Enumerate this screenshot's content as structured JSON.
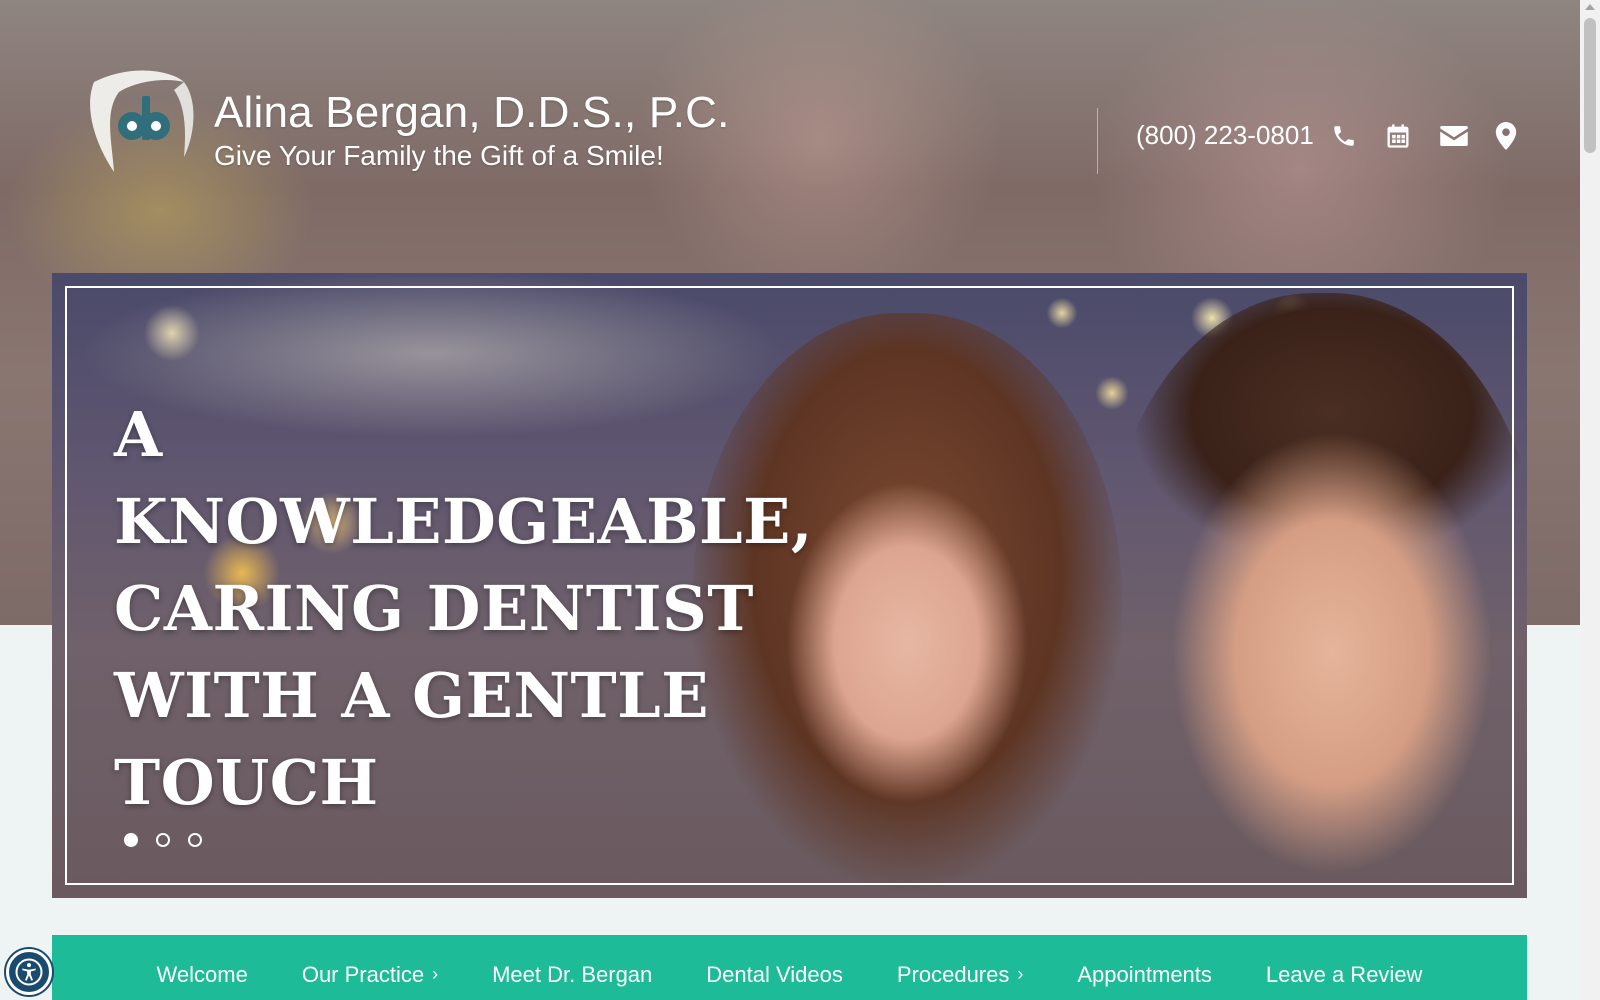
{
  "header": {
    "brand_name": "Alina Bergan, D.D.S., P.C.",
    "tagline": "Give Your Family the Gift of a Smile!",
    "phone": "(800) 223-0801",
    "logo_letters": "ab"
  },
  "contact_icons": [
    "phone-icon",
    "calendar-icon",
    "envelope-icon",
    "map-marker-icon"
  ],
  "hero": {
    "headline": "A KNOWLEDGEABLE, CARING DENTIST WITH A GENTLE TOUCH",
    "slides_total": 3,
    "active_slide": 1
  },
  "nav": {
    "items": [
      {
        "label": "Welcome",
        "has_submenu": false
      },
      {
        "label": "Our Practice",
        "has_submenu": true
      },
      {
        "label": "Meet Dr. Bergan",
        "has_submenu": false
      },
      {
        "label": "Dental Videos",
        "has_submenu": false
      },
      {
        "label": "Procedures",
        "has_submenu": true
      },
      {
        "label": "Appointments",
        "has_submenu": false
      },
      {
        "label": "Leave a Review",
        "has_submenu": false
      }
    ]
  },
  "colors": {
    "nav_bg": "#1dbb98",
    "logo_teal": "#2f6e7a",
    "text_light": "#ffffff",
    "page_bg": "#eef3f3"
  }
}
